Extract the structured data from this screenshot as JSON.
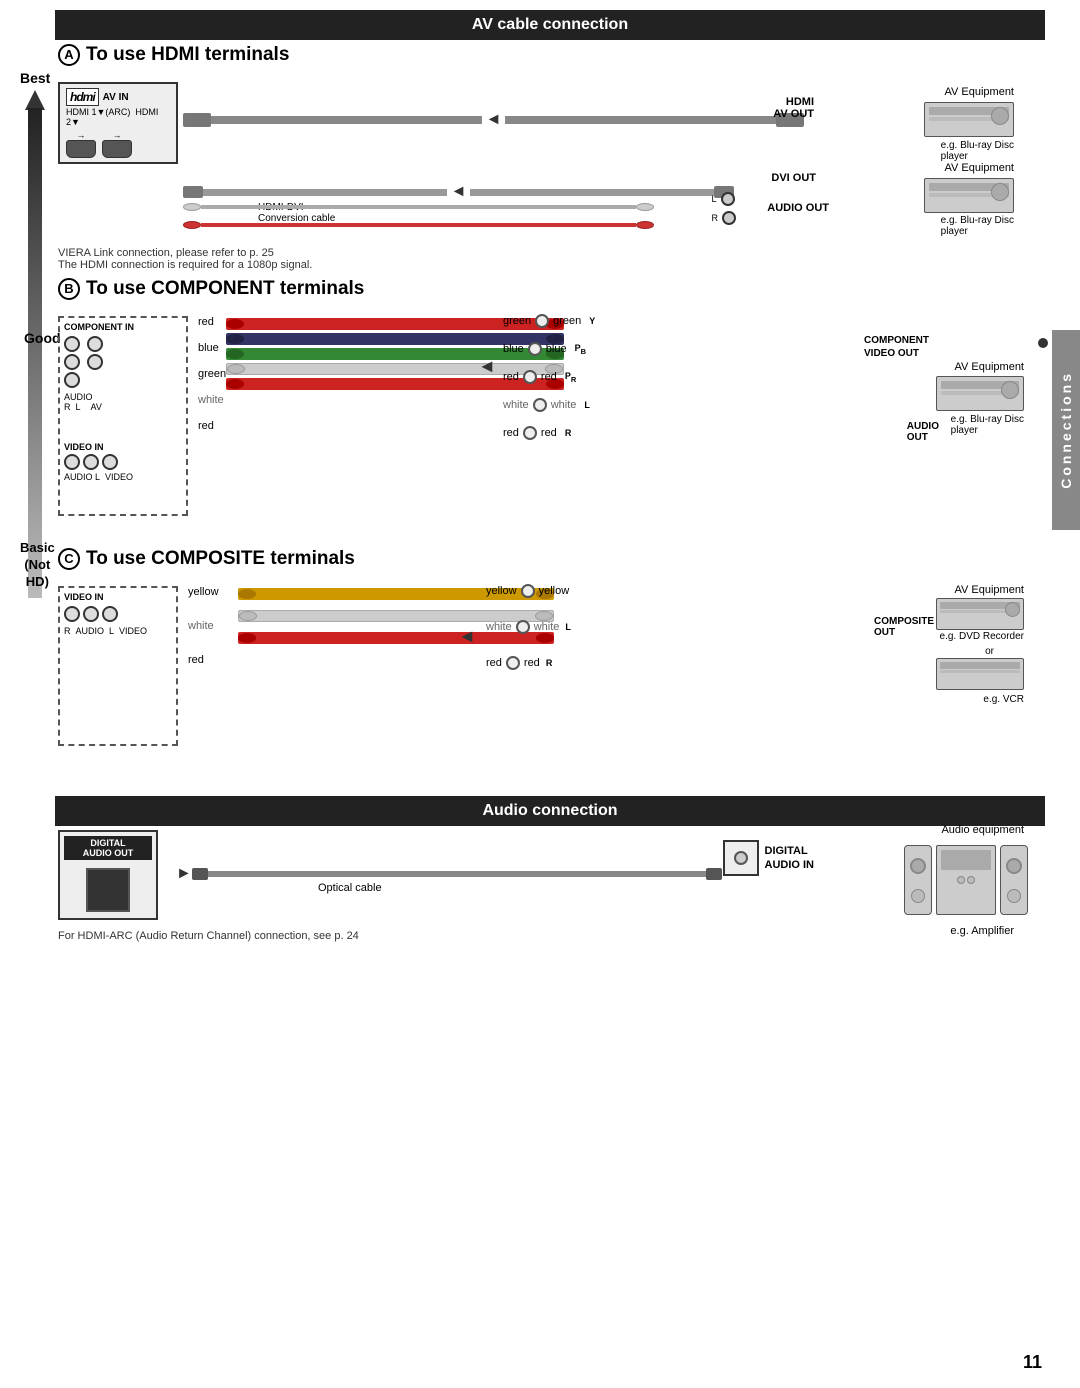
{
  "page": {
    "number": "11",
    "sidebar_label": "Connections"
  },
  "av_cable_section": {
    "header": "AV cable connection",
    "section_a": {
      "title": "To use HDMI terminals",
      "label": "A",
      "tv_label": "AV IN",
      "hdmi_ports": [
        "HDMI 1 ▼(ARC)",
        "HDMI 2 ▼"
      ],
      "connections": [
        {
          "cable": "HDMI cable",
          "from": "HDMI AV OUT",
          "to": "AV Equipment",
          "note": "e.g. Blu-ray Disc player"
        },
        {
          "cable": "HDMI-DVI Conversion cable",
          "from_label": "DVI OUT",
          "audio_label": "AUDIO OUT",
          "audio_channels": [
            "L",
            "R"
          ],
          "to": "AV Equipment",
          "note": "e.g. Blu-ray Disc player"
        }
      ],
      "notes": [
        "VIERA Link connection, please refer to p. 25",
        "The HDMI connection is required for a 1080p signal."
      ]
    },
    "section_b": {
      "title": "To use COMPONENT terminals",
      "label": "B",
      "quality": "Good",
      "wires": [
        {
          "color": "red",
          "label": "red"
        },
        {
          "color": "blue",
          "label": "blue"
        },
        {
          "color": "green",
          "label": "green"
        },
        {
          "color": "white",
          "label": "white"
        },
        {
          "color": "red",
          "label": "red"
        }
      ],
      "middle_labels": [
        "green",
        "blue",
        "red",
        "white",
        "red"
      ],
      "component_labels": [
        "Y",
        "Pb",
        "Pr",
        "L",
        "R"
      ],
      "right_labels": [
        "green",
        "blue",
        "red",
        "white",
        "red"
      ],
      "output_label": "COMPONENT VIDEO OUT",
      "audio_label": "AUDIO OUT",
      "equipment": "AV Equipment",
      "note": "e.g. Blu-ray Disc player"
    },
    "section_c": {
      "title": "To use COMPOSITE terminals",
      "label": "C",
      "quality": "Basic\n(Not HD)",
      "wires": [
        {
          "color": "yellow",
          "label": "yellow"
        },
        {
          "color": "white",
          "label": "white"
        },
        {
          "color": "red",
          "label": "red"
        }
      ],
      "middle_labels": [
        "yellow",
        "white",
        "red"
      ],
      "right_labels": [
        "yellow",
        "white",
        "red"
      ],
      "output_label": "COMPOSITE OUT",
      "audio_label_l": "L",
      "audio_label_r": "R",
      "equipment_1": "e.g. DVD Recorder",
      "equipment_2": "or",
      "equipment_3": "e.g. VCR"
    }
  },
  "audio_section": {
    "header": "Audio connection",
    "digital_label": "DIGITAL\nAUDIO OUT",
    "cable_label": "Optical cable",
    "digital_in_label": "DIGITAL\nAUDIO IN",
    "equipment_label": "Audio equipment",
    "amplifier_note": "e.g. Amplifier",
    "footnote": "For HDMI-ARC (Audio Return Channel) connection, see p. 24"
  },
  "quality_levels": {
    "best": "Best",
    "good": "Good",
    "basic": "Basic\n(Not HD)"
  }
}
